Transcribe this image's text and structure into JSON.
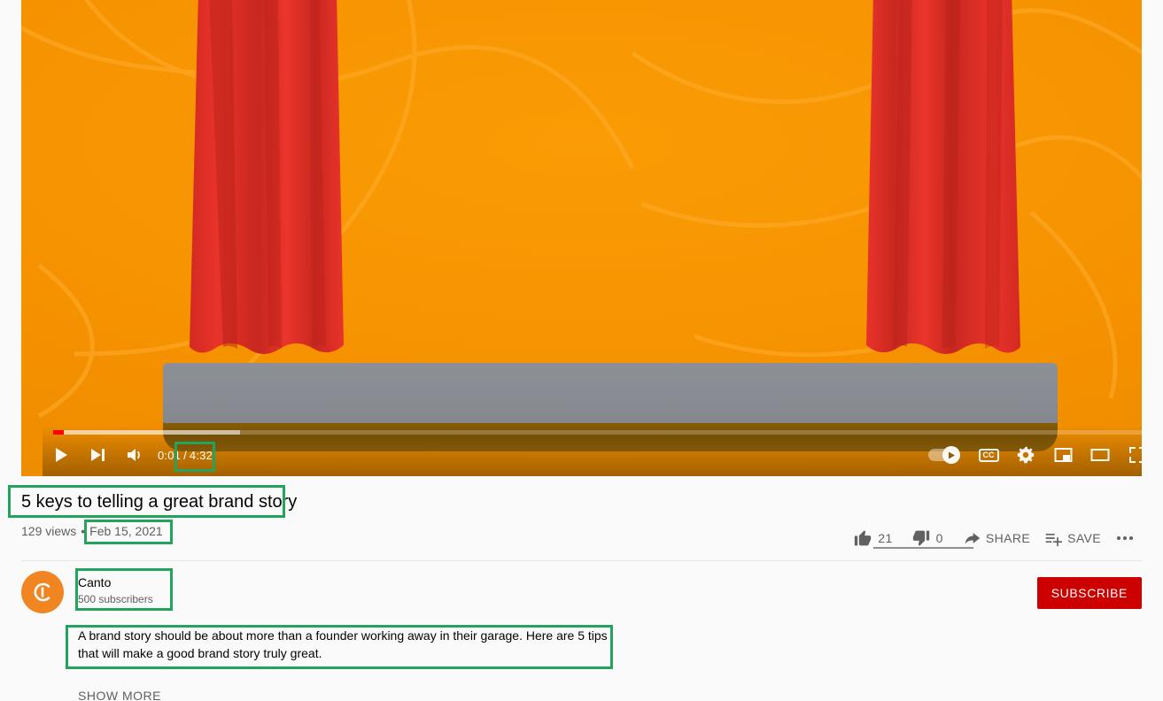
{
  "player": {
    "current_time": "0:01",
    "time_separator": "/",
    "duration": "4:32",
    "progress_played_pct": 1,
    "progress_loaded_pct": 17,
    "controls": {
      "play": "play-button",
      "next": "next-video-button",
      "volume": "volume-button",
      "autoplay": "autoplay-toggle",
      "captions_label": "CC",
      "settings": "settings-gear",
      "miniplayer": "miniplayer-button",
      "theater": "theater-mode-button",
      "fullscreen": "fullscreen-button"
    },
    "scene": {
      "background_color": "#f59100",
      "curtain_color": "#e8332a",
      "stage_color": "#8a8c93",
      "stage_front_color": "#835a07"
    }
  },
  "video": {
    "title": "5 keys to telling a great brand story",
    "views": "129 views",
    "meta_separator": "•",
    "publish_date": "Feb 15, 2021"
  },
  "actions": {
    "like_count": "21",
    "dislike_count": "0",
    "share_label": "SHARE",
    "save_label": "SAVE",
    "like_ratio_pct": 100
  },
  "channel": {
    "avatar_letter": "C",
    "name": "Canto",
    "subscribers": "500 subscribers",
    "subscribe_label": "SUBSCRIBE",
    "avatar_color": "#f18521",
    "subscribe_color": "#cc0000"
  },
  "description": {
    "text": "A brand story should be about more than a founder working away in their garage. Here are 5 tips that will make a good brand story truly great.",
    "show_more_label": "SHOW MORE"
  },
  "highlights": {
    "color": "#22a45d",
    "items": [
      "duration-highlight",
      "title-highlight",
      "date-highlight",
      "channel-highlight",
      "description-highlight"
    ]
  }
}
